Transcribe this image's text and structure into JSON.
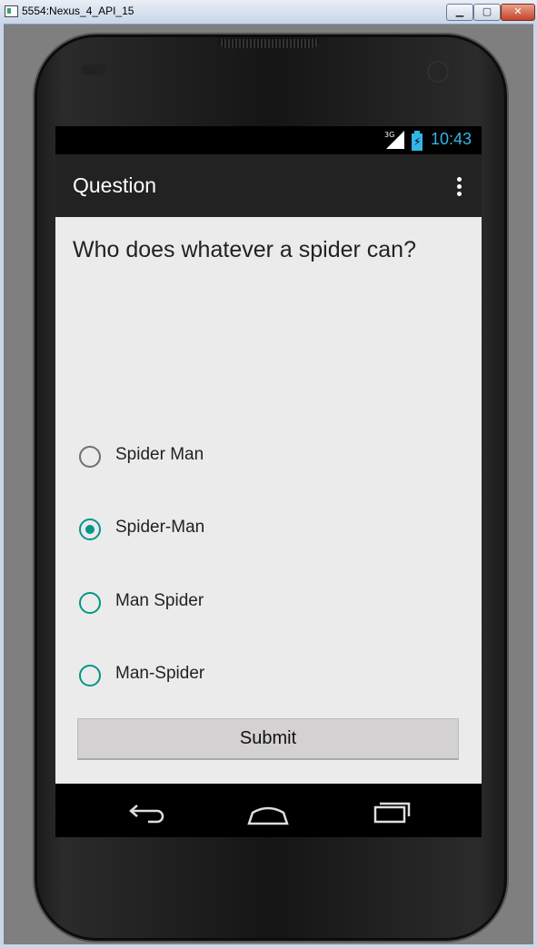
{
  "window": {
    "title": "5554:Nexus_4_API_15",
    "minimize_glyph": "▁",
    "maximize_glyph": "▢",
    "close_glyph": "✕"
  },
  "status_bar": {
    "network": "3G",
    "time": "10:43",
    "accent_color": "#33b5e5"
  },
  "action_bar": {
    "title": "Question",
    "overflow_icon": "overflow-menu-icon"
  },
  "question": {
    "text": "Who does whatever a spider can?"
  },
  "options": [
    {
      "label": "Spider Man",
      "checked": false
    },
    {
      "label": "Spider-Man",
      "checked": true
    },
    {
      "label": "Man Spider",
      "checked": false
    },
    {
      "label": "Man-Spider",
      "checked": false
    }
  ],
  "submit": {
    "label": "Submit"
  },
  "nav_bar": {
    "icons": [
      "back-icon",
      "home-icon",
      "recents-icon"
    ]
  },
  "colors": {
    "radio_accent": "#009688",
    "content_bg": "#ebebeb",
    "action_bar_bg": "#222222"
  }
}
